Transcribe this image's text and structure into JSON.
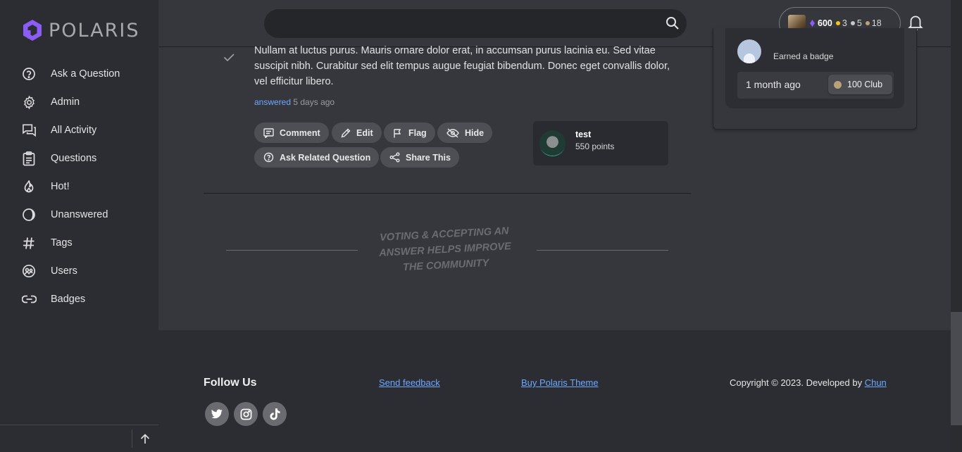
{
  "brand": {
    "name": "POLARIS",
    "accent": "#8b5cf6"
  },
  "sidebar": {
    "items": [
      {
        "label": "Ask a Question",
        "icon": "question-circle-icon"
      },
      {
        "label": "Admin",
        "icon": "gear-icon"
      },
      {
        "label": "All Activity",
        "icon": "chat-bubbles-icon"
      },
      {
        "label": "Questions",
        "icon": "clipboard-icon"
      },
      {
        "label": "Hot!",
        "icon": "flame-icon"
      },
      {
        "label": "Unanswered",
        "icon": "half-circle-icon"
      },
      {
        "label": "Tags",
        "icon": "hash-icon"
      },
      {
        "label": "Users",
        "icon": "users-icon"
      },
      {
        "label": "Badges",
        "icon": "link-icon"
      }
    ]
  },
  "header": {
    "search": {
      "placeholder": ""
    },
    "user": {
      "points": "600",
      "gold": "3",
      "silver": "5",
      "bronze": "18"
    }
  },
  "answer": {
    "text": "Nullam at luctus purus. Mauris ornare dolor erat, in accumsan purus lacinia eu. Sed vitae suscipit nibh. Curabitur sed elit tempus augue feugiat bibendum. Donec eget convallis dolor, vel efficitur libero.",
    "meta_action": "answered",
    "meta_time": "5 days ago",
    "actions": {
      "comment": "Comment",
      "edit": "Edit",
      "flag": "Flag",
      "hide": "Hide",
      "ask_related": "Ask Related Question",
      "share": "Share This"
    },
    "author": {
      "name": "test",
      "points": "550 points"
    }
  },
  "voting_note": "VOTING & ACCEPTING AN ANSWER HELPS IMPROVE THE COMMUNITY",
  "widget": {
    "earned": "Earned a badge",
    "time": "1 month ago",
    "badge": "100 Club"
  },
  "footer": {
    "follow": "Follow Us",
    "feedback": "Send feedback",
    "buy": "Buy Polaris Theme",
    "copyright": "Copyright © 2023. Developed by ",
    "developer": "Chun"
  }
}
